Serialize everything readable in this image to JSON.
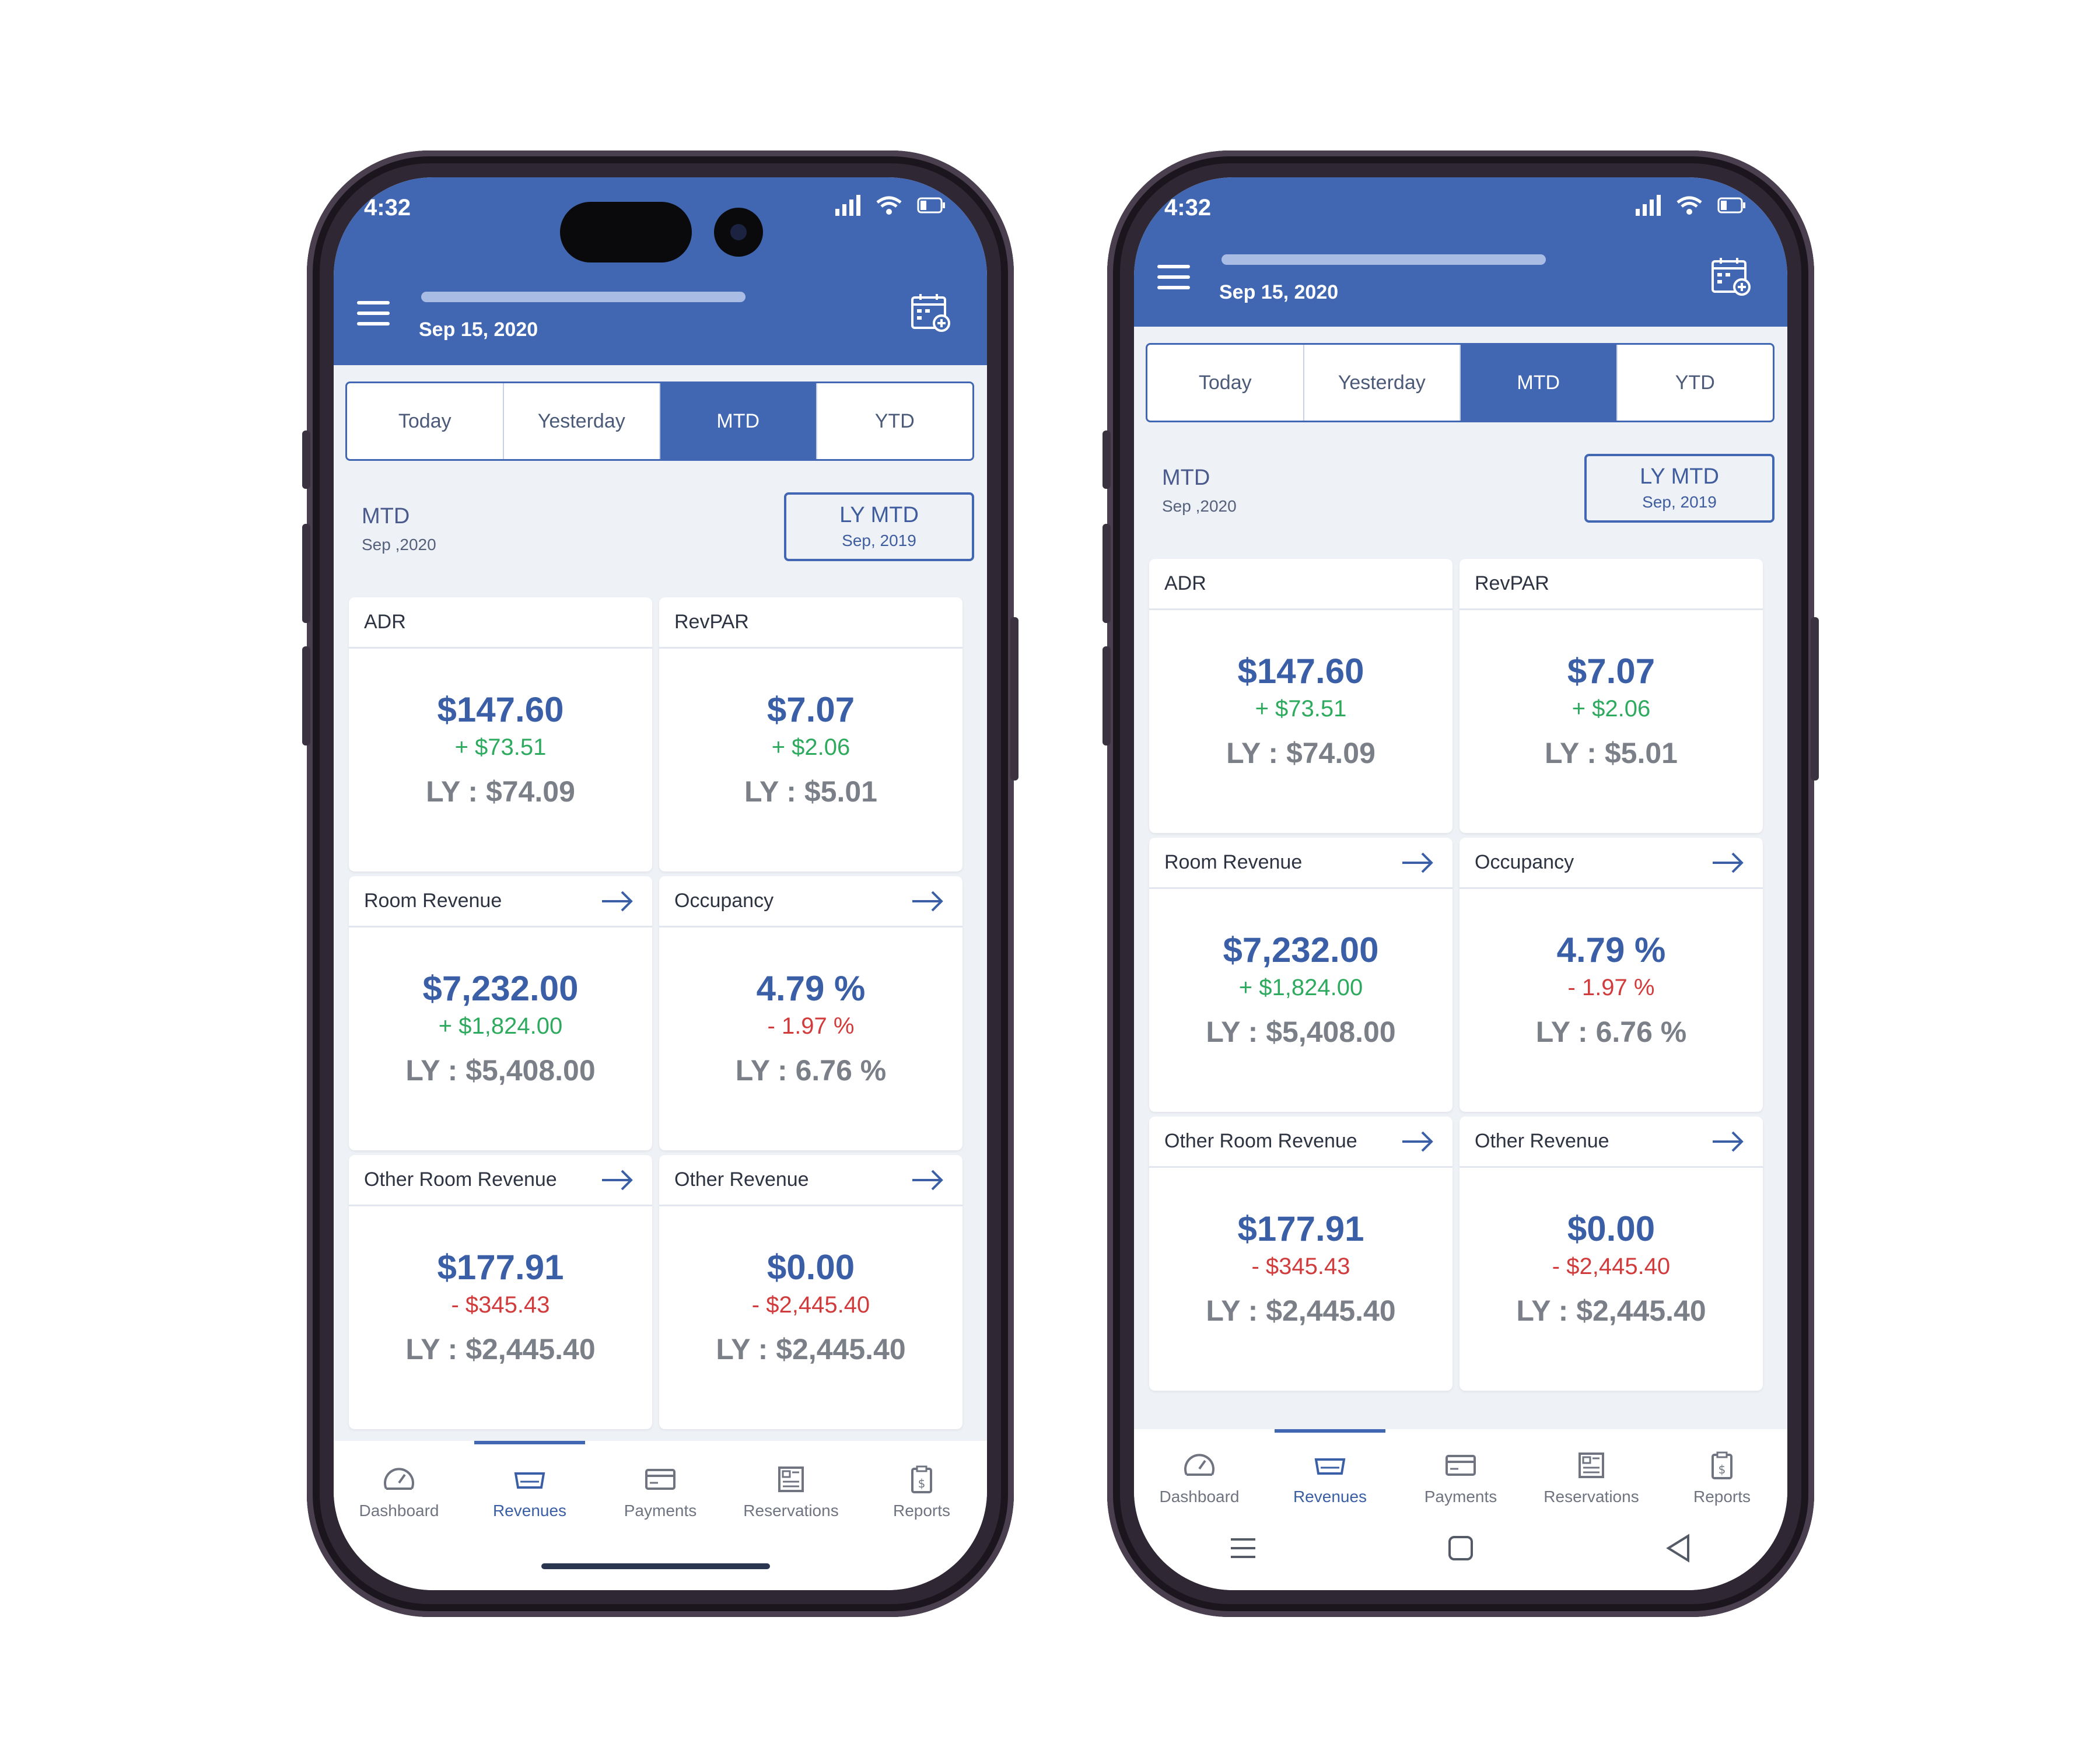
{
  "status": {
    "time": "4:32"
  },
  "header": {
    "date": "Sep 15, 2020"
  },
  "tabs": [
    "Today",
    "Yesterday",
    "MTD",
    "YTD"
  ],
  "active_tab": "MTD",
  "period": {
    "label": "MTD",
    "sub": "Sep ,2020"
  },
  "ly_button": {
    "label": "LY MTD",
    "sub": "Sep, 2019"
  },
  "cards": [
    {
      "title": "ADR",
      "value": "$147.60",
      "delta": "+ $73.51",
      "delta_sign": "positive",
      "ly": "LY : $74.09",
      "has_arrow": false
    },
    {
      "title": "RevPAR",
      "value": "$7.07",
      "delta": "+ $2.06",
      "delta_sign": "positive",
      "ly": "LY : $5.01",
      "has_arrow": false
    },
    {
      "title": "Room Revenue",
      "value": "$7,232.00",
      "delta": "+ $1,824.00",
      "delta_sign": "positive",
      "ly": "LY : $5,408.00",
      "has_arrow": true
    },
    {
      "title": "Occupancy",
      "value": "4.79 %",
      "delta": "- 1.97 %",
      "delta_sign": "negative",
      "ly": "LY : 6.76 %",
      "has_arrow": true
    },
    {
      "title": "Other Room Revenue",
      "value": "$177.91",
      "delta": "- $345.43",
      "delta_sign": "negative",
      "ly": "LY : $2,445.40",
      "has_arrow": true
    },
    {
      "title": "Other Revenue",
      "value": "$0.00",
      "delta": "- $2,445.40",
      "delta_sign": "negative",
      "ly": "LY : $2,445.40",
      "has_arrow": true
    }
  ],
  "nav": [
    {
      "label": "Dashboard",
      "icon": "dashboard-icon"
    },
    {
      "label": "Revenues",
      "icon": "revenues-icon"
    },
    {
      "label": "Payments",
      "icon": "payments-icon"
    },
    {
      "label": "Reservations",
      "icon": "reservations-icon"
    },
    {
      "label": "Reports",
      "icon": "reports-icon"
    }
  ],
  "active_nav": "Revenues",
  "colors": {
    "brand": "#4267b2",
    "positive": "#2eaa5f",
    "negative": "#d23b3b",
    "value": "#3a5fa6",
    "ly": "#7b7f87"
  }
}
